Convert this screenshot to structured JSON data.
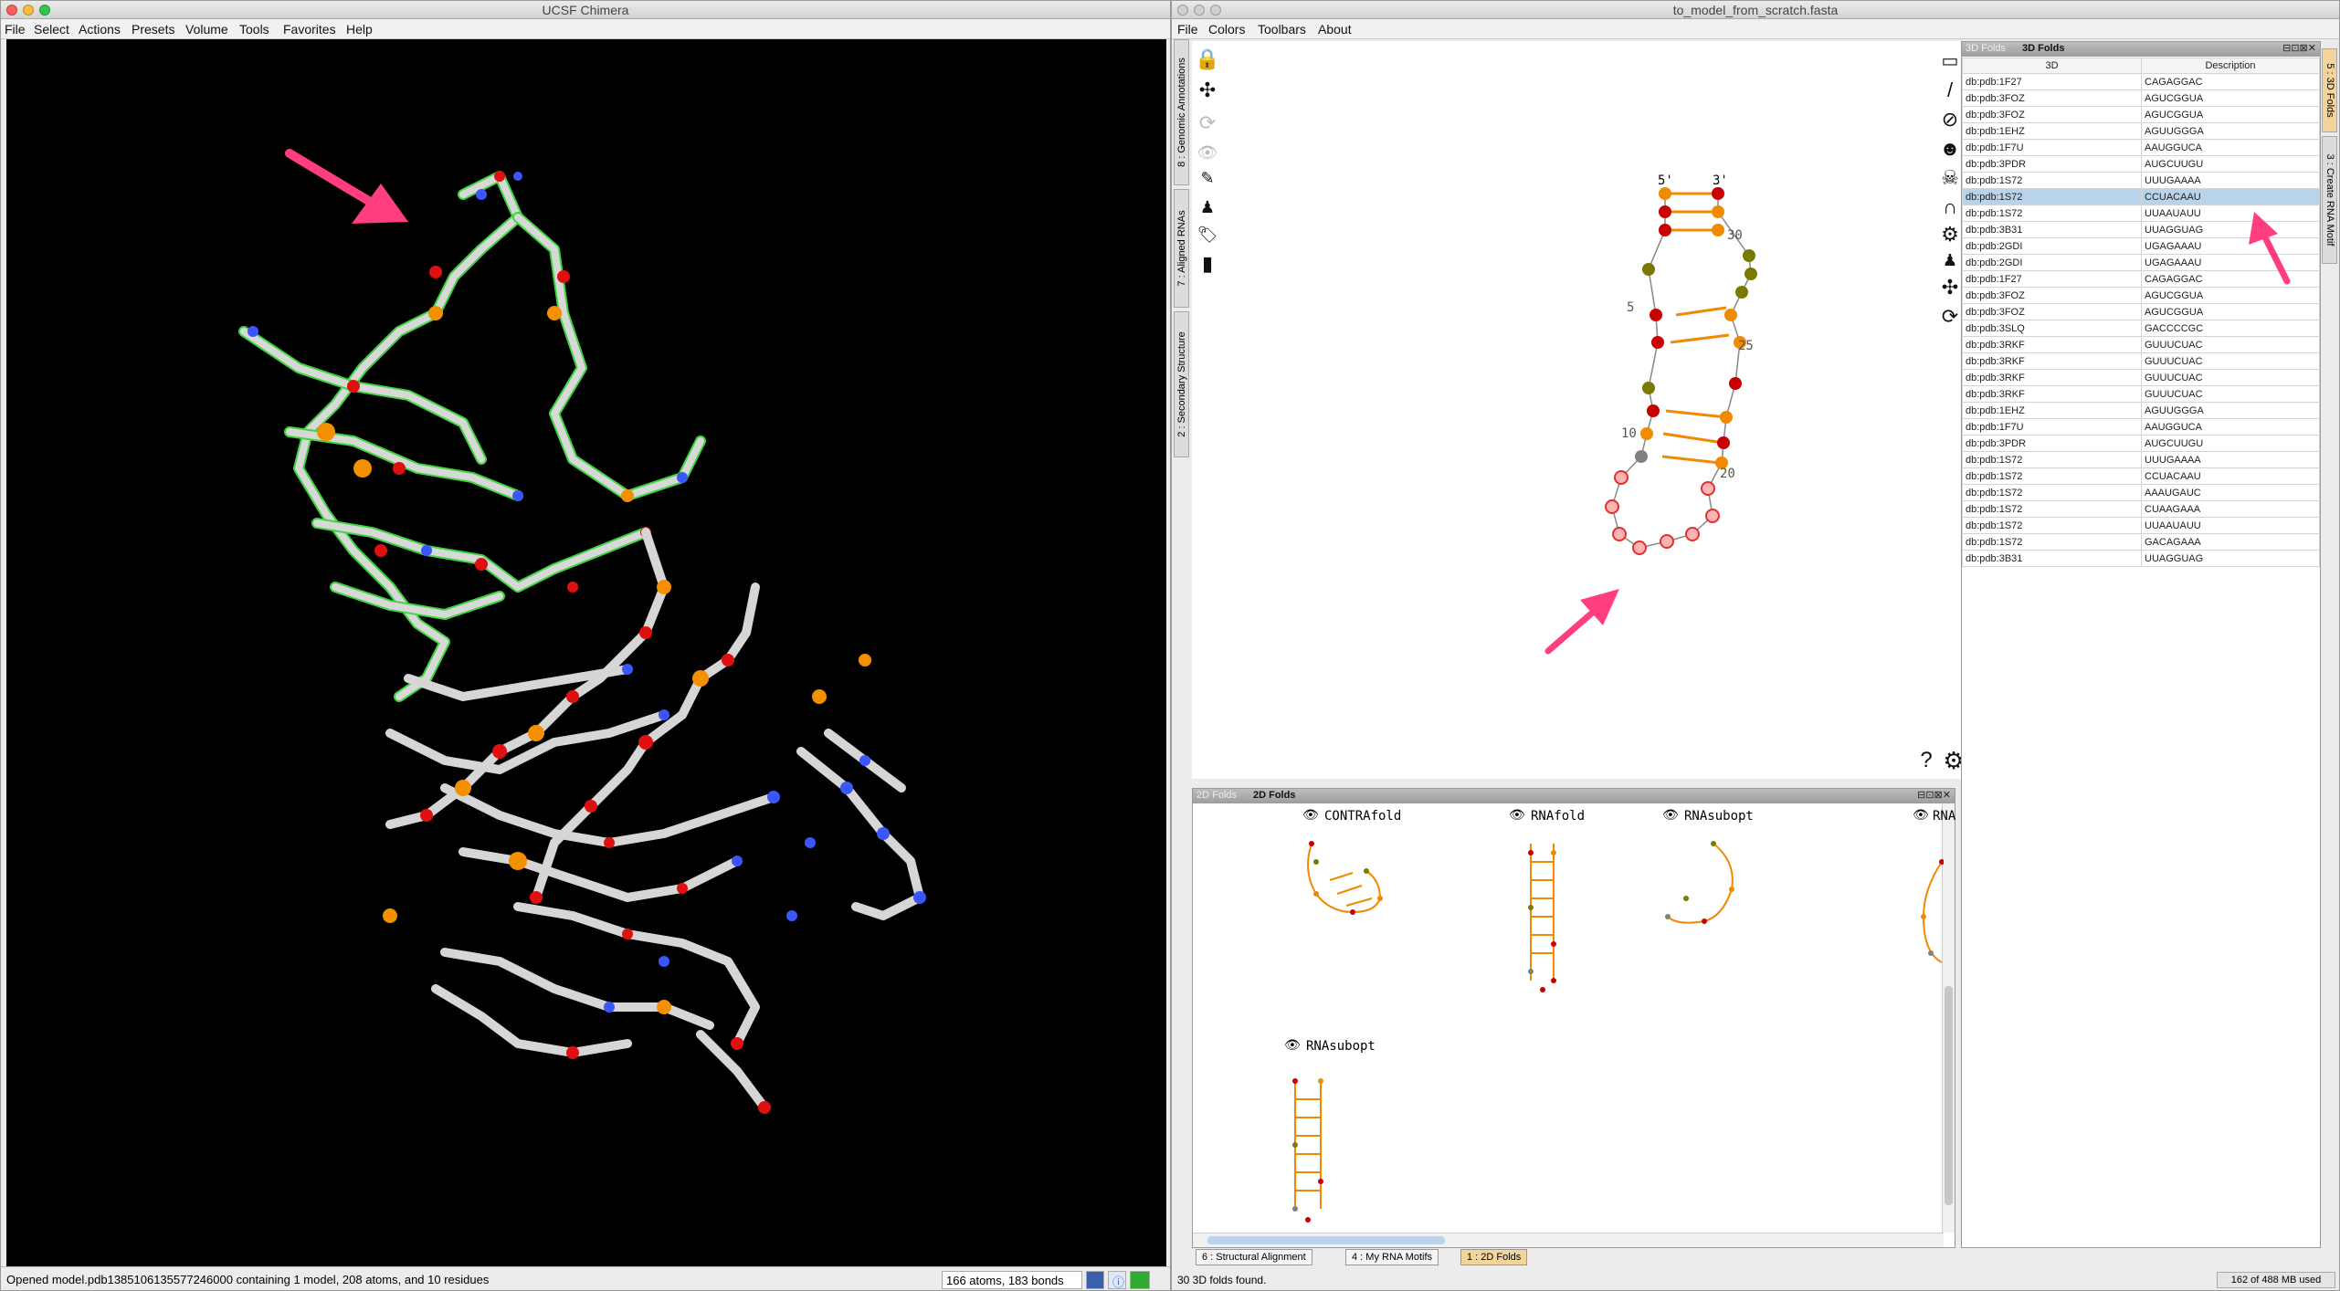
{
  "chimera": {
    "title": "UCSF Chimera",
    "menu": [
      "File",
      "Select",
      "Actions",
      "Presets",
      "Volume",
      "Tools",
      "Favorites",
      "Help"
    ],
    "status": "Opened model.pdb1385106135577246000 containing 1 model, 208 atoms, and 10 residues",
    "counts": "166 atoms, 183 bonds"
  },
  "assemble": {
    "title": "to_model_from_scratch.fasta",
    "menu": [
      "File",
      "Colors",
      "Toolbars",
      "About"
    ],
    "left_tabs": [
      "8 : Genomic Annotations",
      "7 : Aligned RNAs",
      "2 : Secondary Structure"
    ],
    "right_tabs": [
      "5 : 3D Folds",
      "3 : Create RNA Motif"
    ],
    "structure_labels": {
      "five_prime": "5'",
      "three_prime": "3'",
      "n30": "30",
      "n5": "5",
      "n25": "25",
      "n10": "10",
      "n20": "20"
    },
    "folds2d_header": [
      "2D Folds",
      "2D Folds"
    ],
    "folds2d": [
      "CONTRAfold",
      "RNAfold",
      "RNAsubopt",
      "RNA",
      "RNAsubopt"
    ],
    "bottom_tabs": [
      "6 : Structural Alignment",
      "4 : My RNA Motifs",
      "1 : 2D Folds"
    ],
    "status": "30 3D folds found.",
    "memory": "162 of 488 MB used"
  },
  "folds3d": {
    "header": [
      "3D Folds",
      "3D Folds"
    ],
    "columns": [
      "3D",
      "Description"
    ],
    "selected_index": 7,
    "rows": [
      [
        "db:pdb:1F27",
        "CAGAGGAC"
      ],
      [
        "db:pdb:3FOZ",
        "AGUCGGUA"
      ],
      [
        "db:pdb:3FOZ",
        "AGUCGGUA"
      ],
      [
        "db:pdb:1EHZ",
        "AGUUGGGA"
      ],
      [
        "db:pdb:1F7U",
        "AAUGGUCA"
      ],
      [
        "db:pdb:3PDR",
        "AUGCUUGU"
      ],
      [
        "db:pdb:1S72",
        "UUUGAAAA"
      ],
      [
        "db:pdb:1S72",
        "CCUACAAU"
      ],
      [
        "db:pdb:1S72",
        "UUAAUAUU"
      ],
      [
        "db:pdb:3B31",
        "UUAGGUAG"
      ],
      [
        "db:pdb:2GDI",
        "UGAGAAAU"
      ],
      [
        "db:pdb:2GDI",
        "UGAGAAAU"
      ],
      [
        "db:pdb:1F27",
        "CAGAGGAC"
      ],
      [
        "db:pdb:3FOZ",
        "AGUCGGUA"
      ],
      [
        "db:pdb:3FOZ",
        "AGUCGGUA"
      ],
      [
        "db:pdb:3SLQ",
        "GACCCCGC"
      ],
      [
        "db:pdb:3RKF",
        "GUUUCUAC"
      ],
      [
        "db:pdb:3RKF",
        "GUUUCUAC"
      ],
      [
        "db:pdb:3RKF",
        "GUUUCUAC"
      ],
      [
        "db:pdb:3RKF",
        "GUUUCUAC"
      ],
      [
        "db:pdb:1EHZ",
        "AGUUGGGA"
      ],
      [
        "db:pdb:1F7U",
        "AAUGGUCA"
      ],
      [
        "db:pdb:3PDR",
        "AUGCUUGU"
      ],
      [
        "db:pdb:1S72",
        "UUUGAAAA"
      ],
      [
        "db:pdb:1S72",
        "CCUACAAU"
      ],
      [
        "db:pdb:1S72",
        "AAAUGAUC"
      ],
      [
        "db:pdb:1S72",
        "CUAAGAAA"
      ],
      [
        "db:pdb:1S72",
        "UUAAUAUU"
      ],
      [
        "db:pdb:1S72",
        "GACAGAAA"
      ],
      [
        "db:pdb:3B31",
        "UUAGGUAG"
      ]
    ]
  },
  "colors": {
    "orange": "#f08a00",
    "red": "#c80000",
    "olive": "#7a7a00",
    "grey": "#808080",
    "arrow": "#ff3d7f",
    "tab_active": "#f3d49b"
  }
}
